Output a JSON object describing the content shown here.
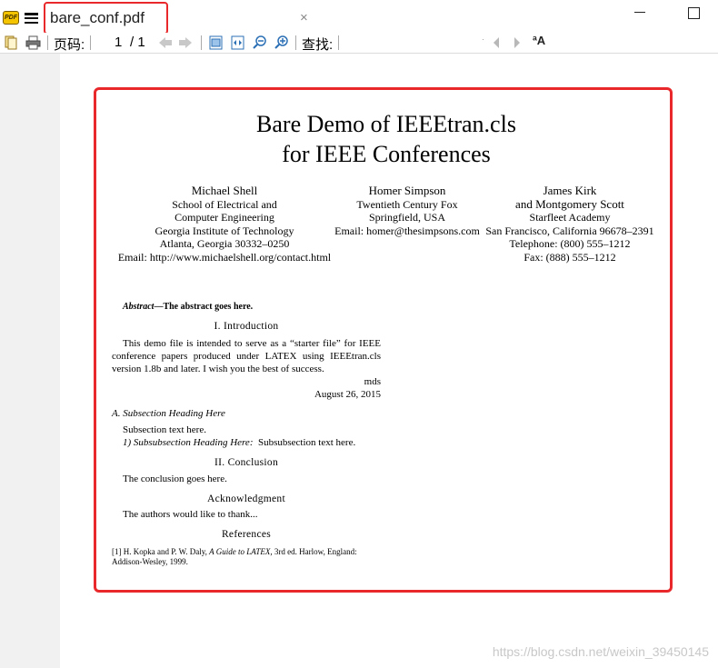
{
  "titlebar": {
    "app_icon_text": "PDF",
    "tab_title": "bare_conf.pdf",
    "close_glyph": "×"
  },
  "toolbar": {
    "page_label": "页码:",
    "page_current": "1",
    "page_total": "/ 1",
    "find_label": "查找:",
    "font_glyph": "ªA"
  },
  "document": {
    "title_line1": "Bare Demo of IEEEtran.cls",
    "title_line2": "for IEEE Conferences",
    "authors": [
      {
        "name": "Michael Shell",
        "lines": [
          "School of Electrical and",
          "Computer Engineering",
          "Georgia Institute of Technology",
          "Atlanta, Georgia 30332–0250",
          "Email: http://www.michaelshell.org/contact.html"
        ]
      },
      {
        "name": "Homer Simpson",
        "lines": [
          "Twentieth Century Fox",
          "Springfield, USA",
          "Email: homer@thesimpsons.com"
        ]
      },
      {
        "name": "James Kirk",
        "lines": [
          "and Montgomery Scott",
          "Starfleet Academy",
          "San Francisco, California 96678–2391",
          "Telephone: (800) 555–1212",
          "Fax: (888) 555–1212"
        ]
      }
    ],
    "abstract_label": "Abstract",
    "abstract_text": "—The abstract goes here.",
    "sections": {
      "intro": "I. Introduction",
      "conclusion": "II. Conclusion",
      "acknowledgment": "Acknowledgment",
      "references": "References"
    },
    "intro_paragraph": "This demo file is intended to serve as a “starter file” for IEEE conference papers produced under LATEX using IEEEtran.cls version 1.8b and later. I wish you the best of success.",
    "signature": "mds",
    "date": "August 26, 2015",
    "subsection_heading": "A. Subsection Heading Here",
    "subsection_text": "Subsection text here.",
    "subsubsection_heading": "1) Subsubsection Heading Here:",
    "subsubsection_text": "Subsubsection text here.",
    "conclusion_text": "The conclusion goes here.",
    "acknowledgment_text": "The authors would like to thank...",
    "reference_1_number": "[1]",
    "reference_1_authors": "H. Kopka and P. W. Daly,",
    "reference_1_title": "A Guide to LATEX,",
    "reference_1_rest": "3rd ed.   Harlow, England: Addison-Wesley, 1999."
  },
  "watermark": "https://blog.csdn.net/weixin_39450145",
  "colors": {
    "highlight": "#e8282b",
    "gutter": "#f1f1f1",
    "app_icon": "#f5c400"
  }
}
